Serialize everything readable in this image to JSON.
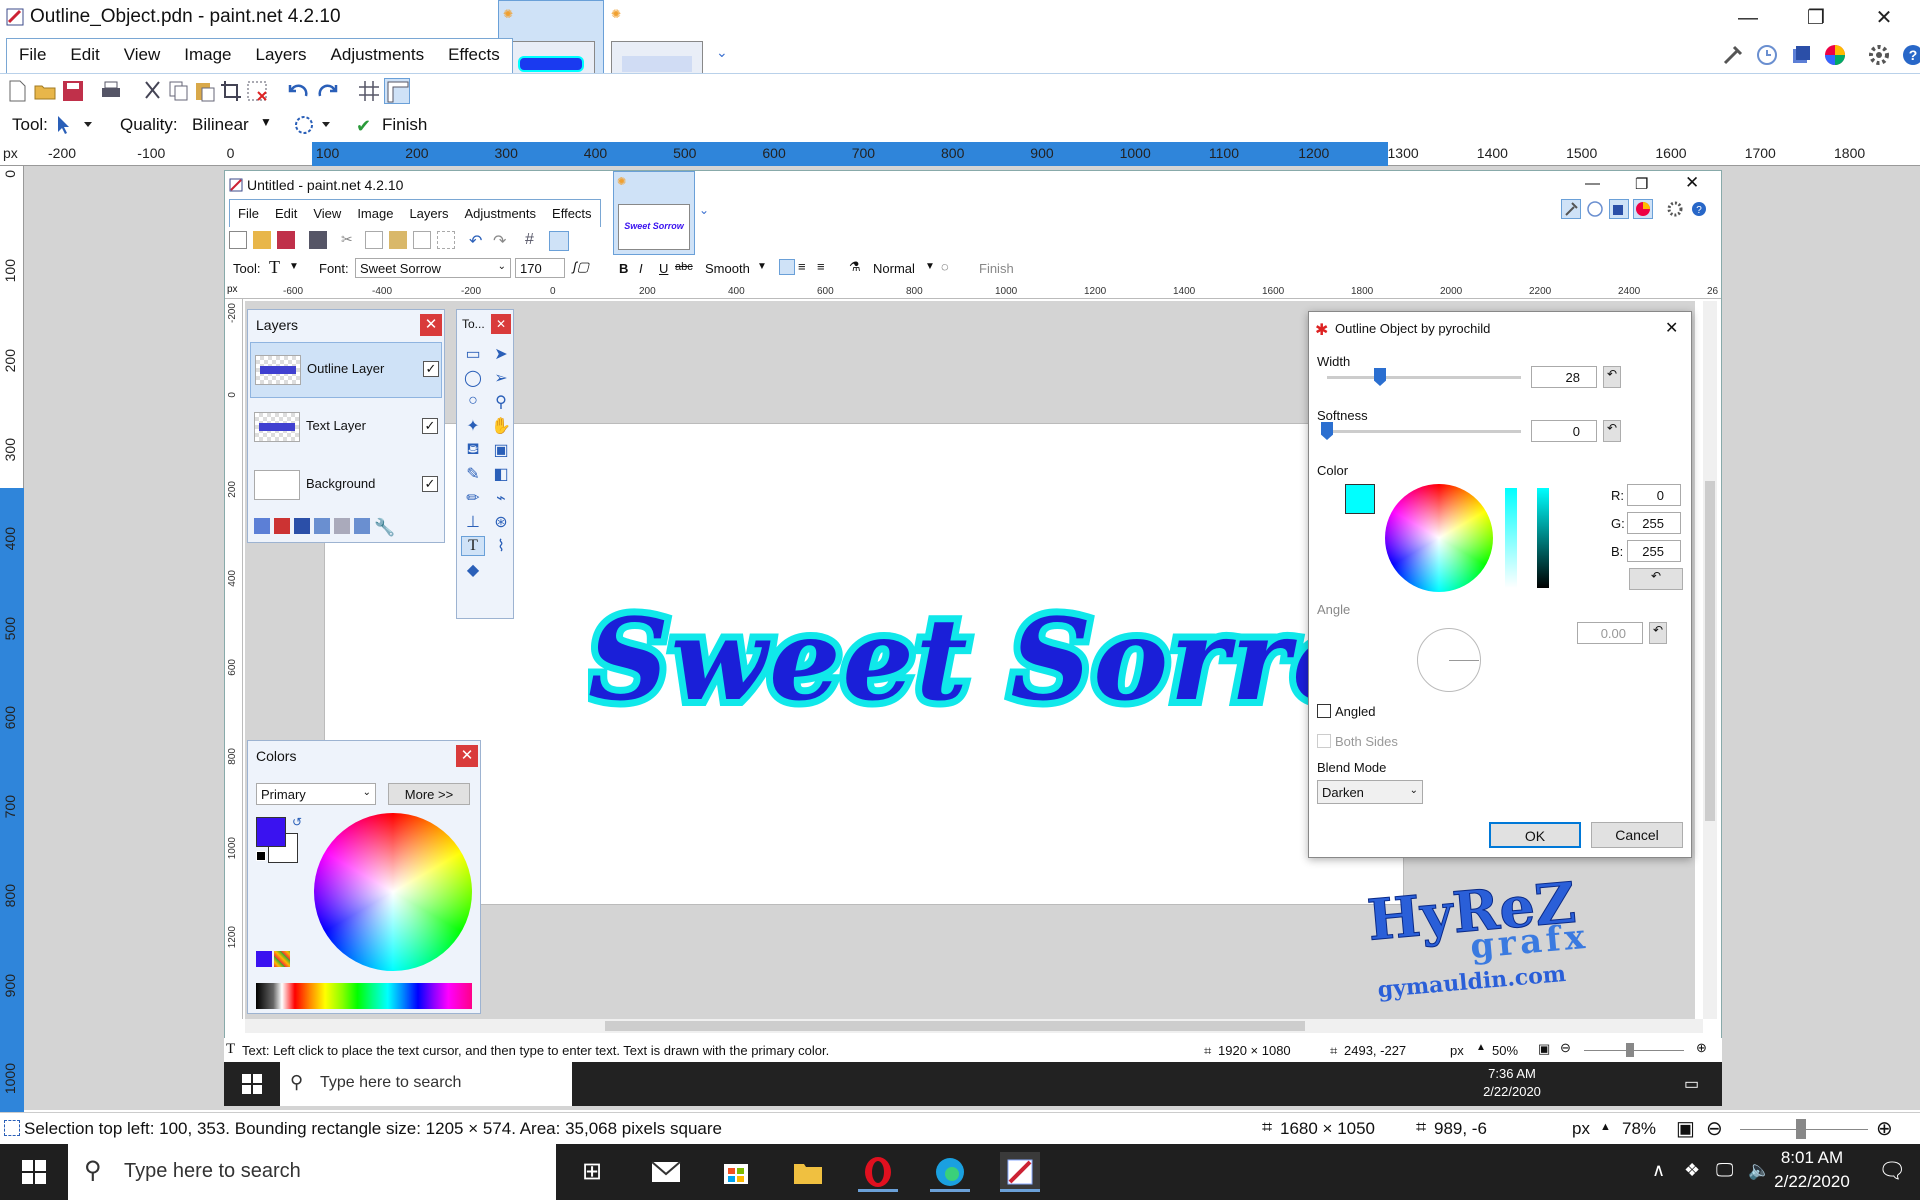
{
  "outer": {
    "title": "Outline_Object.pdn - paint.net 4.2.10",
    "menu": [
      "File",
      "Edit",
      "View",
      "Image",
      "Layers",
      "Adjustments",
      "Effects"
    ],
    "tool_label": "Tool:",
    "quality_label": "Quality:",
    "quality_value": "Bilinear",
    "finish_label": "Finish",
    "ruler_unit": "px",
    "top_ruler": [
      "-200",
      "-100",
      "0",
      "100",
      "200",
      "300",
      "400",
      "500",
      "600",
      "700",
      "800",
      "900",
      "1000",
      "1100",
      "1200",
      "1300",
      "1400",
      "1500",
      "1600",
      "1700",
      "1800"
    ],
    "left_ruler": [
      "0",
      "100",
      "200",
      "300",
      "400",
      "500",
      "600",
      "700",
      "800",
      "900",
      "1000"
    ],
    "status_text": "Selection top left: 100, 353. Bounding rectangle size: 1205 × 574. Area: 35,068 pixels square",
    "image_size": "1680 × 1050",
    "cursor_pos": "989, -6",
    "unit": "px",
    "zoom": "78%"
  },
  "inner": {
    "title": "Untitled - paint.net 4.2.10",
    "menu": [
      "File",
      "Edit",
      "View",
      "Image",
      "Layers",
      "Adjustments",
      "Effects"
    ],
    "tool_label": "Tool:",
    "font_label": "Font:",
    "font_value": "Sweet Sorrow",
    "font_size": "170",
    "bold": "B",
    "italic": "I",
    "underline": "U",
    "strike": "abc",
    "smoothing": "Smooth",
    "blend": "Normal",
    "finish_label": "Finish",
    "ruler_unit": "px",
    "top_ruler": [
      "-600",
      "-400",
      "-200",
      "0",
      "200",
      "400",
      "600",
      "800",
      "1000",
      "1200",
      "1400",
      "1600",
      "1800",
      "2000",
      "2200",
      "2400",
      "26"
    ],
    "left_ruler": [
      "-200",
      "0",
      "200",
      "400",
      "600",
      "800",
      "1000",
      "1200"
    ],
    "status_text": "Text: Left click to place the text cursor, and then type to enter text. Text is drawn with the primary color.",
    "image_size": "1920 × 1080",
    "cursor_pos": "2493, -227",
    "unit": "px",
    "zoom": "50%",
    "taskbar_search": "Type here to search",
    "taskbar_time": "7:36 AM",
    "taskbar_date": "2/22/2020",
    "thumb_text": "Sweet Sorrow"
  },
  "canvas_text": "Sweet Sorrow",
  "layers": {
    "title": "Layers",
    "items": [
      {
        "name": "Outline Layer",
        "checked": true
      },
      {
        "name": "Text Layer",
        "checked": true
      },
      {
        "name": "Background",
        "checked": true
      }
    ]
  },
  "tools_panel": {
    "title": "To..."
  },
  "colors_panel": {
    "title": "Colors",
    "select": "Primary",
    "more": "More >>",
    "primary_color": "#3a12f0"
  },
  "dialog": {
    "title": "Outline Object by pyrochild",
    "width_label": "Width",
    "width_value": "28",
    "softness_label": "Softness",
    "softness_value": "0",
    "color_label": "Color",
    "swatch": "#00ffff",
    "r_label": "R:",
    "r_value": "0",
    "g_label": "G:",
    "g_value": "255",
    "b_label": "B:",
    "b_value": "255",
    "angle_label": "Angle",
    "angle_value": "0.00",
    "angled_label": "Angled",
    "both_sides_label": "Both Sides",
    "blend_label": "Blend Mode",
    "blend_value": "Darken",
    "ok": "OK",
    "cancel": "Cancel"
  },
  "watermark": {
    "line1": "HyReZ",
    "line2": "grafx",
    "line3": "gymauldin.com"
  },
  "taskbar": {
    "search_placeholder": "Type here to search",
    "time": "8:01 AM",
    "date": "2/22/2020"
  }
}
